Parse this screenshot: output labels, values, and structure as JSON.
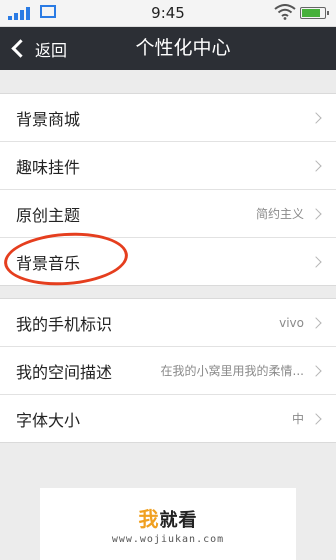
{
  "status_bar": {
    "time": "9:45",
    "icons": [
      "signal-icon",
      "image-icon",
      "wifi-icon",
      "battery-icon"
    ]
  },
  "header": {
    "back_label": "返回",
    "title": "个性化中心"
  },
  "group1": {
    "items": [
      {
        "label": "背景商城",
        "value": ""
      },
      {
        "label": "趣味挂件",
        "value": ""
      },
      {
        "label": "原创主题",
        "value": "简约主义"
      },
      {
        "label": "背景音乐",
        "value": ""
      }
    ]
  },
  "group2": {
    "items": [
      {
        "label": "我的手机标识",
        "value": "vivo"
      },
      {
        "label": "我的空间描述",
        "value": "在我的小窝里用我的柔情..."
      },
      {
        "label": "字体大小",
        "value": "中"
      }
    ]
  },
  "colors": {
    "title_bar": "#2c2f35",
    "annotation_ring": "#e53e1e",
    "signal": "#2a7be4"
  },
  "watermark": {
    "brand_prefix": "我",
    "brand_rest": "就看",
    "url": "www.wojiukan.com"
  }
}
